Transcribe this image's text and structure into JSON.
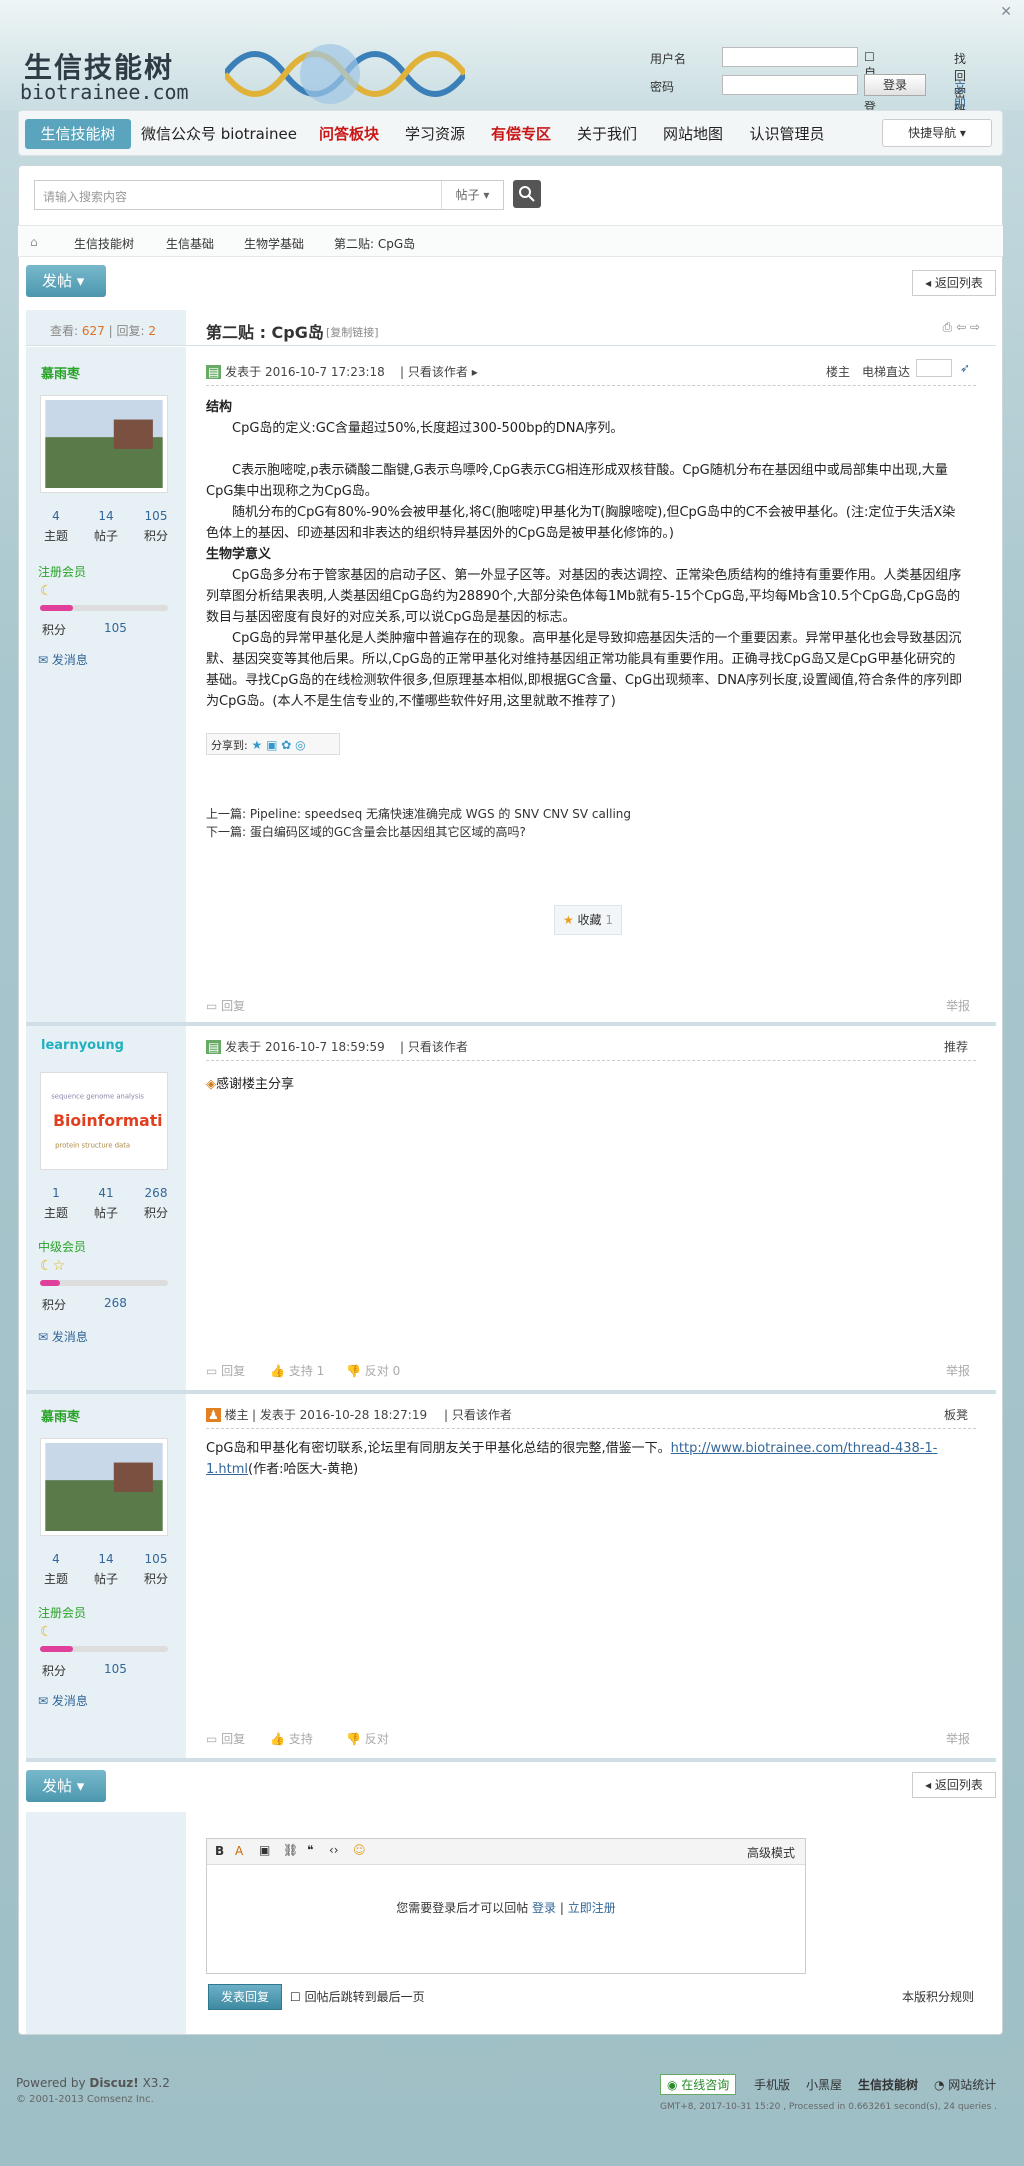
{
  "header": {
    "logo_cn": "生信技能树",
    "logo_en": "biotrainee.com",
    "login": {
      "username_label": "用户名",
      "password_label": "密码",
      "auto_login": "自动登录",
      "login_btn": "登录",
      "forgot": "找回密码",
      "register": "立即注册"
    }
  },
  "nav": {
    "items": [
      "生信技能树",
      "微信公众号 biotrainee",
      "问答板块",
      "学习资源",
      "有偿专区",
      "关于我们",
      "网站地图",
      "认识管理员"
    ],
    "quick": "快捷导航"
  },
  "search": {
    "placeholder": "请输入搜索内容",
    "select": "帖子"
  },
  "breadcrumb": [
    "生信技能树",
    "生信基础",
    "生物学基础",
    "第二贴: CpG岛"
  ],
  "actions": {
    "post": "发帖",
    "back": "返回列表"
  },
  "thread": {
    "title": "第二贴 : CpG岛",
    "copy_link": "[复制链接]",
    "views_label": "查看:",
    "views": "627",
    "replies_label": "回复:",
    "replies": "2"
  },
  "posts": [
    {
      "user": "慕雨枣",
      "stats": [
        {
          "v": "4",
          "l": "主题"
        },
        {
          "v": "14",
          "l": "帖子"
        },
        {
          "v": "105",
          "l": "积分"
        }
      ],
      "group": "注册会员",
      "points_label": "积分",
      "points": "105",
      "pm": "发消息",
      "time": "发表于 2016-10-7 17:23:18",
      "only_author": "只看该作者",
      "floor": "楼主",
      "jump_label": "电梯直达",
      "h1": "结构",
      "p1": "CpG岛的定义:GC含量超过50%,长度超过300-500bp的DNA序列。",
      "p2": "C表示胞嘧啶,p表示磷酸二酯键,G表示鸟嘌呤,CpG表示CG相连形成双核苷酸。CpG随机分布在基因组中或局部集中出现,大量CpG集中出现称之为CpG岛。",
      "p3": "随机分布的CpG有80%-90%会被甲基化,将C(胞嘧啶)甲基化为T(胸腺嘧啶),但CpG岛中的C不会被甲基化。(注:定位于失活X染色体上的基因、印迹基因和非表达的组织特异基因外的CpG岛是被甲基化修饰的。)",
      "h2": "生物学意义",
      "p4": "CpG岛多分布于管家基因的启动子区、第一外显子区等。对基因的表达调控、正常染色质结构的维持有重要作用。人类基因组序列草图分析结果表明,人类基因组CpG岛约为28890个,大部分染色体每1Mb就有5-15个CpG岛,平均每Mb含10.5个CpG岛,CpG岛的数目与基因密度有良好的对应关系,可以说CpG岛是基因的标志。",
      "p5": "CpG岛的异常甲基化是人类肿瘤中普遍存在的现象。高甲基化是导致抑癌基因失活的一个重要因素。异常甲基化也会导致基因沉默、基因突变等其他后果。所以,CpG岛的正常甲基化对维持基因组正常功能具有重要作用。正确寻找CpG岛又是CpG甲基化研究的基础。寻找CpG岛的在线检测软件很多,但原理基本相似,即根据GC含量、CpG出现频率、DNA序列长度,设置阈值,符合条件的序列即为CpG岛。(本人不是生信专业的,不懂哪些软件好用,这里就敢不推荐了)",
      "share": "分享到:",
      "prev": "上一篇: Pipeline: speedseq 无痛快速准确完成 WGS 的 SNV CNV SV calling",
      "next": "下一篇: 蛋白编码区域的GC含量会比基因组其它区域的高吗?",
      "fav": "收藏",
      "fav_count": "1",
      "reply": "回复",
      "report": "举报"
    },
    {
      "user": "learnyoung",
      "stats": [
        {
          "v": "1",
          "l": "主题"
        },
        {
          "v": "41",
          "l": "帖子"
        },
        {
          "v": "268",
          "l": "积分"
        }
      ],
      "group": "中级会员",
      "points_label": "积分",
      "points": "268",
      "pm": "发消息",
      "time": "发表于 2016-10-7 18:59:59",
      "only_author": "只看该作者",
      "floor": "推荐",
      "body": "感谢楼主分享",
      "reply": "回复",
      "support": "支持 1",
      "oppose": "反对 0",
      "report": "举报"
    },
    {
      "user": "慕雨枣",
      "stats": [
        {
          "v": "4",
          "l": "主题"
        },
        {
          "v": "14",
          "l": "帖子"
        },
        {
          "v": "105",
          "l": "积分"
        }
      ],
      "group": "注册会员",
      "points_label": "积分",
      "points": "105",
      "pm": "发消息",
      "owner": "楼主",
      "time": "发表于 2016-10-28 18:27:19",
      "only_author": "只看该作者",
      "floor": "板凳",
      "body": "CpG岛和甲基化有密切联系,论坛里有同朋友关于甲基化总结的很完整,借鉴一下。",
      "link": "http://www.biotrainee.com/thread-438-1-1.html",
      "body_tail": "(作者:哈医大-黄艳)",
      "reply": "回复",
      "support": "支持",
      "oppose": "反对",
      "report": "举报"
    }
  ],
  "editor": {
    "advanced": "高级模式",
    "notice": "您需要登录后才可以回帖",
    "login": "登录",
    "sep": "|",
    "register": "立即注册",
    "submit": "发表回复",
    "jump_last": "回帖后跳转到最后一页",
    "rules": "本版积分规则"
  },
  "footer": {
    "powered": "Powered by",
    "discuz": "Discuz!",
    "ver": "X3.2",
    "copy": "© 2001-2013 Comsenz Inc.",
    "links": [
      "在线咨询",
      "手机版",
      "小黑屋",
      "生信技能树",
      "网站统计"
    ],
    "gmt": "GMT+8, 2017-10-31 15:20 , Processed in 0.663261 second(s), 24 queries ."
  }
}
